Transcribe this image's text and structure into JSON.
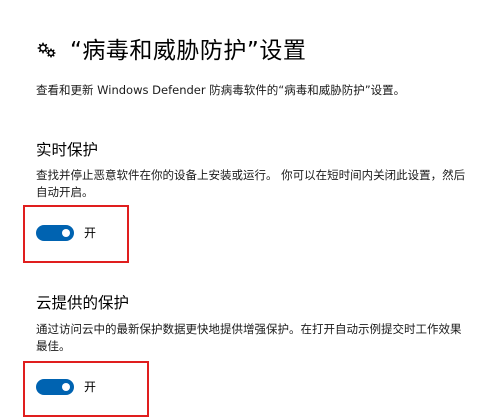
{
  "header": {
    "icon": "gear-cluster-icon",
    "title": "“病毒和威胁防护”设置",
    "description": "查看和更新 Windows Defender 防病毒软件的“病毒和威胁防护”设置。"
  },
  "sections": [
    {
      "title": "实时保护",
      "description": "查找并停止恶意软件在你的设备上安装或运行。 你可以在短时间内关闭此设置，然后自动开启。",
      "toggle_on": true,
      "toggle_label": "开"
    },
    {
      "title": "云提供的保护",
      "description": "通过访问云中的最新保护数据更快地提供增强保护。在打开自动示例提交时工作效果最佳。",
      "toggle_on": true,
      "toggle_label": "开"
    }
  ],
  "colors": {
    "accent": "#0063b1",
    "highlight": "#e01e1e"
  }
}
